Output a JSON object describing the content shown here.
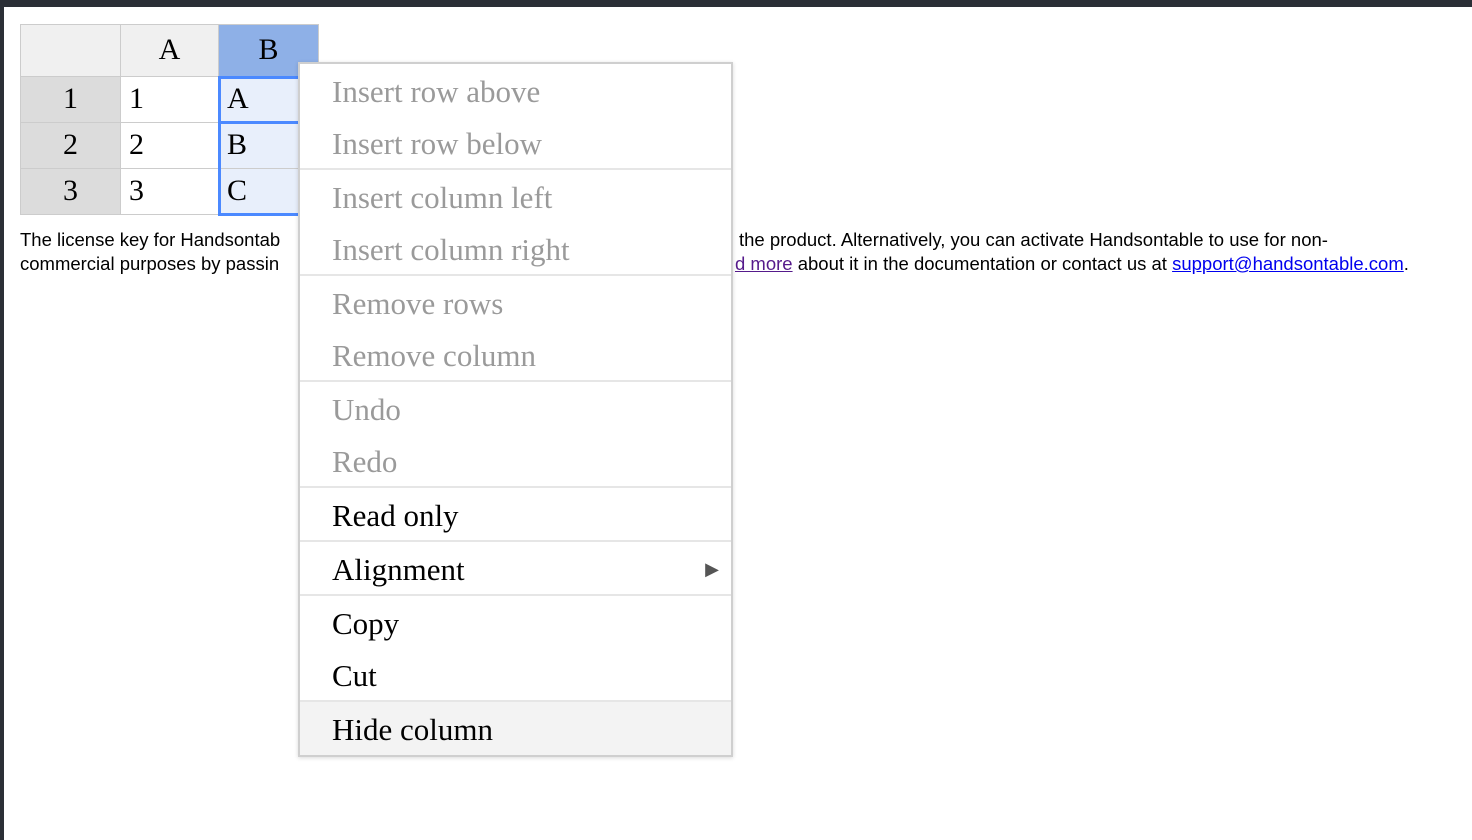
{
  "grid": {
    "columns": [
      "A",
      "B"
    ],
    "rows": [
      {
        "header": "1",
        "cells": [
          "1",
          "A"
        ]
      },
      {
        "header": "2",
        "cells": [
          "2",
          "B"
        ]
      },
      {
        "header": "3",
        "cells": [
          "3",
          "C"
        ]
      }
    ]
  },
  "license": {
    "line1_start": "The license key for Handsontab",
    "line1_end": "the product. Alternatively, you can activate Handsontable to use for non-",
    "line2_start": "commercial purposes by passin",
    "line2_link": "d more",
    "line2_mid": " about it in the documentation or contact us at ",
    "line2_email": "support@handsontable.com",
    "line2_end": "."
  },
  "context_menu": {
    "items": [
      {
        "label": "Insert row above",
        "enabled": false
      },
      {
        "label": "Insert row below",
        "enabled": false
      },
      {
        "label": "Insert column left",
        "enabled": false
      },
      {
        "label": "Insert column right",
        "enabled": false
      },
      {
        "label": "Remove rows",
        "enabled": false
      },
      {
        "label": "Remove column",
        "enabled": false
      },
      {
        "label": "Undo",
        "enabled": false
      },
      {
        "label": "Redo",
        "enabled": false
      },
      {
        "label": "Read only",
        "enabled": true
      },
      {
        "label": "Alignment",
        "enabled": true,
        "submenu_icon": "triangle-right-icon"
      },
      {
        "label": "Copy",
        "enabled": true
      },
      {
        "label": "Cut",
        "enabled": true
      },
      {
        "label": "Hide column",
        "enabled": true,
        "highlighted": true
      }
    ]
  },
  "colors": {
    "selected_header": "#8eb0e7",
    "selected_cell": "#e8effb",
    "selection_border": "#4b89ff",
    "disabled_text": "#9a9a9a",
    "link": "#0000ee",
    "visited_link": "#551a8b"
  }
}
